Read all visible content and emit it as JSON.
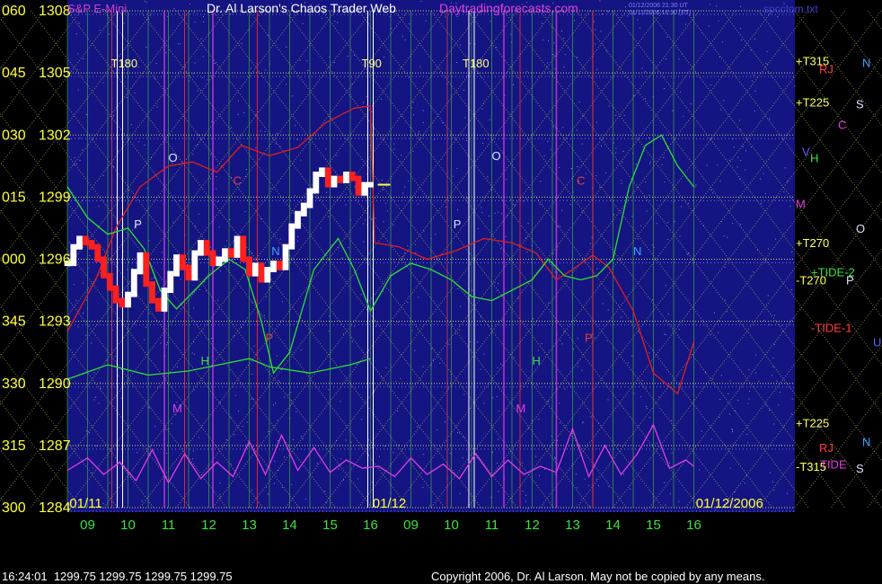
{
  "header": {
    "left_title": "S&P E-Mini",
    "main_title": "Dr. Al Larson's Chaos Trader Web",
    "site": "Daytradingforecasts.com",
    "info_line1": "01/12/2006 21:30 UT",
    "info_line2": "01/11/2006 16:30 (ET)",
    "file_name": "spcctom.txt"
  },
  "footer": {
    "quote": "16:24:01  1299.75 1299.75 1299.75 1299.75",
    "copyright": "Copyright 2006, Dr. Al Larson. May not be copied by any means."
  },
  "chart_data": {
    "type": "line",
    "y_axis": {
      "range": [
        1284,
        1308
      ],
      "ticks": [
        {
          "deg": "060",
          "price": "1308",
          "value": 1308
        },
        {
          "deg": "045",
          "price": "1305",
          "value": 1305
        },
        {
          "deg": "030",
          "price": "1302",
          "value": 1302
        },
        {
          "deg": "015",
          "price": "1299",
          "value": 1299
        },
        {
          "deg": "000",
          "price": "1296",
          "value": 1296
        },
        {
          "deg": "345",
          "price": "1293",
          "value": 1293
        },
        {
          "deg": "330",
          "price": "1290",
          "value": 1290
        },
        {
          "deg": "315",
          "price": "1287",
          "value": 1287
        },
        {
          "deg": "300",
          "price": "1284",
          "value": 1284
        }
      ]
    },
    "x_axis": {
      "range": [
        8.5,
        26.5
      ],
      "ticks": [
        {
          "label": "09",
          "x": 9
        },
        {
          "label": "10",
          "x": 10
        },
        {
          "label": "11",
          "x": 11
        },
        {
          "label": "12",
          "x": 12
        },
        {
          "label": "13",
          "x": 13
        },
        {
          "label": "14",
          "x": 14
        },
        {
          "label": "15",
          "x": 15
        },
        {
          "label": "16",
          "x": 16
        },
        {
          "label": "09",
          "x": 17
        },
        {
          "label": "10",
          "x": 18
        },
        {
          "label": "11",
          "x": 19
        },
        {
          "label": "12",
          "x": 20
        },
        {
          "label": "13",
          "x": 21
        },
        {
          "label": "14",
          "x": 22
        },
        {
          "label": "15",
          "x": 23
        },
        {
          "label": "16",
          "x": 24
        }
      ],
      "dates": [
        {
          "label": "01/11",
          "x": 8.55
        },
        {
          "label": "01/12",
          "x": 16.05
        },
        {
          "label": "01/12/2006",
          "x": 24.05
        }
      ]
    },
    "vertical_markers": [
      {
        "label": "T180",
        "x": 9.8
      },
      {
        "label": "T90",
        "x": 16.0
      },
      {
        "label": "T180",
        "x": 18.5
      }
    ],
    "right_labels": [
      {
        "text": "+T315",
        "y": 1305.6,
        "color": "#ffff66"
      },
      {
        "text": "RJ",
        "y": 1305.2,
        "color": "#ff4040"
      },
      {
        "text": "N",
        "y": 1305.5,
        "color": "#40a0ff"
      },
      {
        "text": "+T225",
        "y": 1303.6,
        "color": "#ffff66"
      },
      {
        "text": "S",
        "y": 1303.5,
        "color": "#e0e0ff"
      },
      {
        "text": "C",
        "y": 1302.5,
        "color": "#e040e0"
      },
      {
        "text": "V",
        "y": 1301.2,
        "color": "#6060ff"
      },
      {
        "text": "H",
        "y": 1300.9,
        "color": "#40e040"
      },
      {
        "text": "M",
        "y": 1298.7,
        "color": "#e040e0"
      },
      {
        "text": "O",
        "y": 1297.5,
        "color": "#e0e0ff"
      },
      {
        "text": "+T270",
        "y": 1296.8,
        "color": "#ffff66"
      },
      {
        "text": "+TIDE-2",
        "y": 1295.4,
        "color": "#40e040"
      },
      {
        "text": "-T270",
        "y": 1295.0,
        "color": "#ffff66"
      },
      {
        "text": "P",
        "y": 1295.0,
        "color": "#e0e0ff"
      },
      {
        "text": "-TIDE-1",
        "y": 1292.7,
        "color": "#ff4040"
      },
      {
        "text": "U",
        "y": 1292.0,
        "color": "#6060ff"
      },
      {
        "text": "+T225",
        "y": 1288.1,
        "color": "#ffff66"
      },
      {
        "text": "N",
        "y": 1287.2,
        "color": "#40a0ff"
      },
      {
        "text": "RJ",
        "y": 1286.9,
        "color": "#ff4040"
      },
      {
        "text": "-T315",
        "y": 1286.0,
        "color": "#ffff66"
      },
      {
        "text": "TIDE",
        "y": 1286.1,
        "color": "#e040e0"
      },
      {
        "text": "S",
        "y": 1285.9,
        "color": "#e0e0ff"
      }
    ],
    "plot_letters": [
      {
        "text": "O",
        "x": 11.0,
        "y": 1300.7,
        "color": "#e0e0ff"
      },
      {
        "text": "P",
        "x": 10.15,
        "y": 1297.5,
        "color": "#e0e0ff"
      },
      {
        "text": "C",
        "x": 12.6,
        "y": 1299.6,
        "color": "#e04040"
      },
      {
        "text": "N",
        "x": 13.55,
        "y": 1296.2,
        "color": "#40a0ff"
      },
      {
        "text": "P",
        "x": 13.4,
        "y": 1292.0,
        "color": "#e04040"
      },
      {
        "text": "H",
        "x": 11.8,
        "y": 1290.9,
        "color": "#40e040"
      },
      {
        "text": "M",
        "x": 11.1,
        "y": 1288.6,
        "color": "#e040e0"
      },
      {
        "text": "O",
        "x": 19.0,
        "y": 1300.8,
        "color": "#e0e0ff"
      },
      {
        "text": "P",
        "x": 18.05,
        "y": 1297.5,
        "color": "#e0e0ff"
      },
      {
        "text": "C",
        "x": 21.1,
        "y": 1299.6,
        "color": "#e04040"
      },
      {
        "text": "N",
        "x": 22.5,
        "y": 1296.2,
        "color": "#40a0ff"
      },
      {
        "text": "P",
        "x": 21.3,
        "y": 1292.0,
        "color": "#e04040"
      },
      {
        "text": "H",
        "x": 20.0,
        "y": 1290.9,
        "color": "#40e040"
      },
      {
        "text": "M",
        "x": 19.6,
        "y": 1288.6,
        "color": "#e040e0"
      }
    ],
    "series": [
      {
        "name": "S&P E-Mini",
        "color": "#ffffff",
        "down_color": "#ff2020",
        "x": [
          8.5,
          8.65,
          8.8,
          8.95,
          9.1,
          9.25,
          9.4,
          9.55,
          9.7,
          9.85,
          10.0,
          10.15,
          10.3,
          10.45,
          10.6,
          10.75,
          10.9,
          11.05,
          11.2,
          11.35,
          11.5,
          11.65,
          11.8,
          11.95,
          12.1,
          12.25,
          12.4,
          12.55,
          12.7,
          12.85,
          13.0,
          13.15,
          13.3,
          13.45,
          13.6,
          13.75,
          13.9,
          14.05,
          14.2,
          14.35,
          14.5,
          14.65,
          14.8,
          14.95,
          15.1,
          15.25,
          15.4,
          15.55,
          15.7,
          15.85,
          16.0
        ],
        "y": [
          1295.8,
          1296.6,
          1297.0,
          1296.8,
          1296.6,
          1296.0,
          1295.2,
          1294.6,
          1294.0,
          1293.8,
          1294.3,
          1295.4,
          1296.2,
          1294.8,
          1294.0,
          1293.6,
          1294.5,
          1295.3,
          1296.1,
          1295.6,
          1295.1,
          1296.3,
          1296.8,
          1296.3,
          1295.8,
          1296.0,
          1296.4,
          1296.2,
          1297.0,
          1296.0,
          1295.3,
          1295.7,
          1295.0,
          1295.5,
          1295.8,
          1295.6,
          1296.6,
          1297.6,
          1298.2,
          1298.6,
          1299.3,
          1300.1,
          1300.3,
          1299.6,
          1299.9,
          1299.8,
          1300.1,
          1299.9,
          1299.2,
          1299.6,
          1299.6
        ]
      },
      {
        "name": "TIDE-1",
        "color": "#e02020",
        "x": [
          8.5,
          9.2,
          9.7,
          10.3,
          11.0,
          11.6,
          12.2,
          12.8,
          13.5,
          14.2,
          14.9,
          15.6,
          16.0,
          16.1,
          16.7,
          17.4,
          18.1,
          18.8,
          19.5,
          20.1,
          20.6,
          21.0,
          21.5,
          21.9,
          22.5,
          23.0,
          23.6,
          24.0
        ],
        "y": [
          1292.5,
          1295.0,
          1297.5,
          1299.5,
          1300.5,
          1300.7,
          1300.2,
          1301.5,
          1301.0,
          1301.4,
          1302.6,
          1303.3,
          1303.4,
          1296.8,
          1296.6,
          1296.0,
          1296.4,
          1297.0,
          1296.8,
          1296.3,
          1295.0,
          1295.5,
          1296.2,
          1295.6,
          1293.5,
          1290.5,
          1289.5,
          1292.0
        ]
      },
      {
        "name": "TIDE-2",
        "color": "#30e030",
        "x": [
          8.5,
          9.0,
          9.5,
          10.0,
          10.4,
          10.8,
          11.2,
          11.5,
          12.0,
          12.5,
          12.9,
          13.3,
          13.6,
          14.0,
          14.6,
          15.2,
          15.6,
          16.0,
          16.5,
          17.0,
          17.5,
          18.0,
          18.5,
          19.0,
          19.5,
          20.0,
          20.4,
          20.8,
          21.2,
          21.6,
          22.0,
          22.4,
          22.8,
          23.2,
          23.6,
          24.0
        ],
        "y": [
          1299.5,
          1298.0,
          1297.2,
          1297.5,
          1296.5,
          1294.5,
          1293.6,
          1294.2,
          1295.2,
          1296.0,
          1295.5,
          1293.0,
          1290.5,
          1291.5,
          1295.5,
          1297.0,
          1295.5,
          1293.5,
          1295.2,
          1295.8,
          1295.5,
          1295.0,
          1294.2,
          1294.0,
          1294.5,
          1295.0,
          1296.0,
          1295.2,
          1295.0,
          1295.2,
          1296.0,
          1299.5,
          1301.5,
          1302.0,
          1300.5,
          1299.5
        ]
      },
      {
        "name": "HarmonicLow",
        "color": "#30e030",
        "x": [
          8.5,
          9.5,
          10.5,
          11.5,
          12.5,
          13.0,
          13.5,
          14.5,
          15.5,
          16.0
        ],
        "y": [
          1290.2,
          1290.9,
          1290.4,
          1290.6,
          1291.0,
          1291.2,
          1290.8,
          1290.5,
          1290.9,
          1291.2
        ]
      },
      {
        "name": "TIDE",
        "color": "#e040e0",
        "x": [
          8.5,
          9.0,
          9.4,
          9.8,
          10.2,
          10.6,
          11.0,
          11.4,
          11.8,
          12.2,
          12.6,
          13.0,
          13.4,
          13.8,
          14.2,
          14.6,
          15.0,
          15.4,
          15.8,
          16.2,
          16.6,
          17.0,
          17.4,
          17.8,
          18.2,
          18.6,
          19.0,
          19.4,
          19.8,
          20.2,
          20.6,
          21.0,
          21.4,
          21.8,
          22.2,
          22.6,
          23.0,
          23.4,
          23.8,
          24.0
        ],
        "y": [
          1285.8,
          1286.4,
          1285.6,
          1286.2,
          1285.3,
          1286.8,
          1285.2,
          1286.6,
          1285.4,
          1286.2,
          1285.5,
          1287.2,
          1285.6,
          1287.5,
          1285.8,
          1286.9,
          1285.7,
          1286.3,
          1285.9,
          1286.0,
          1285.5,
          1286.4,
          1285.6,
          1286.1,
          1285.4,
          1286.6,
          1285.5,
          1286.3,
          1285.6,
          1286.0,
          1285.7,
          1287.8,
          1285.5,
          1287.0,
          1285.6,
          1286.6,
          1288.0,
          1285.9,
          1286.3,
          1286.0
        ]
      }
    ],
    "grid": true,
    "legend": "right-labels"
  }
}
